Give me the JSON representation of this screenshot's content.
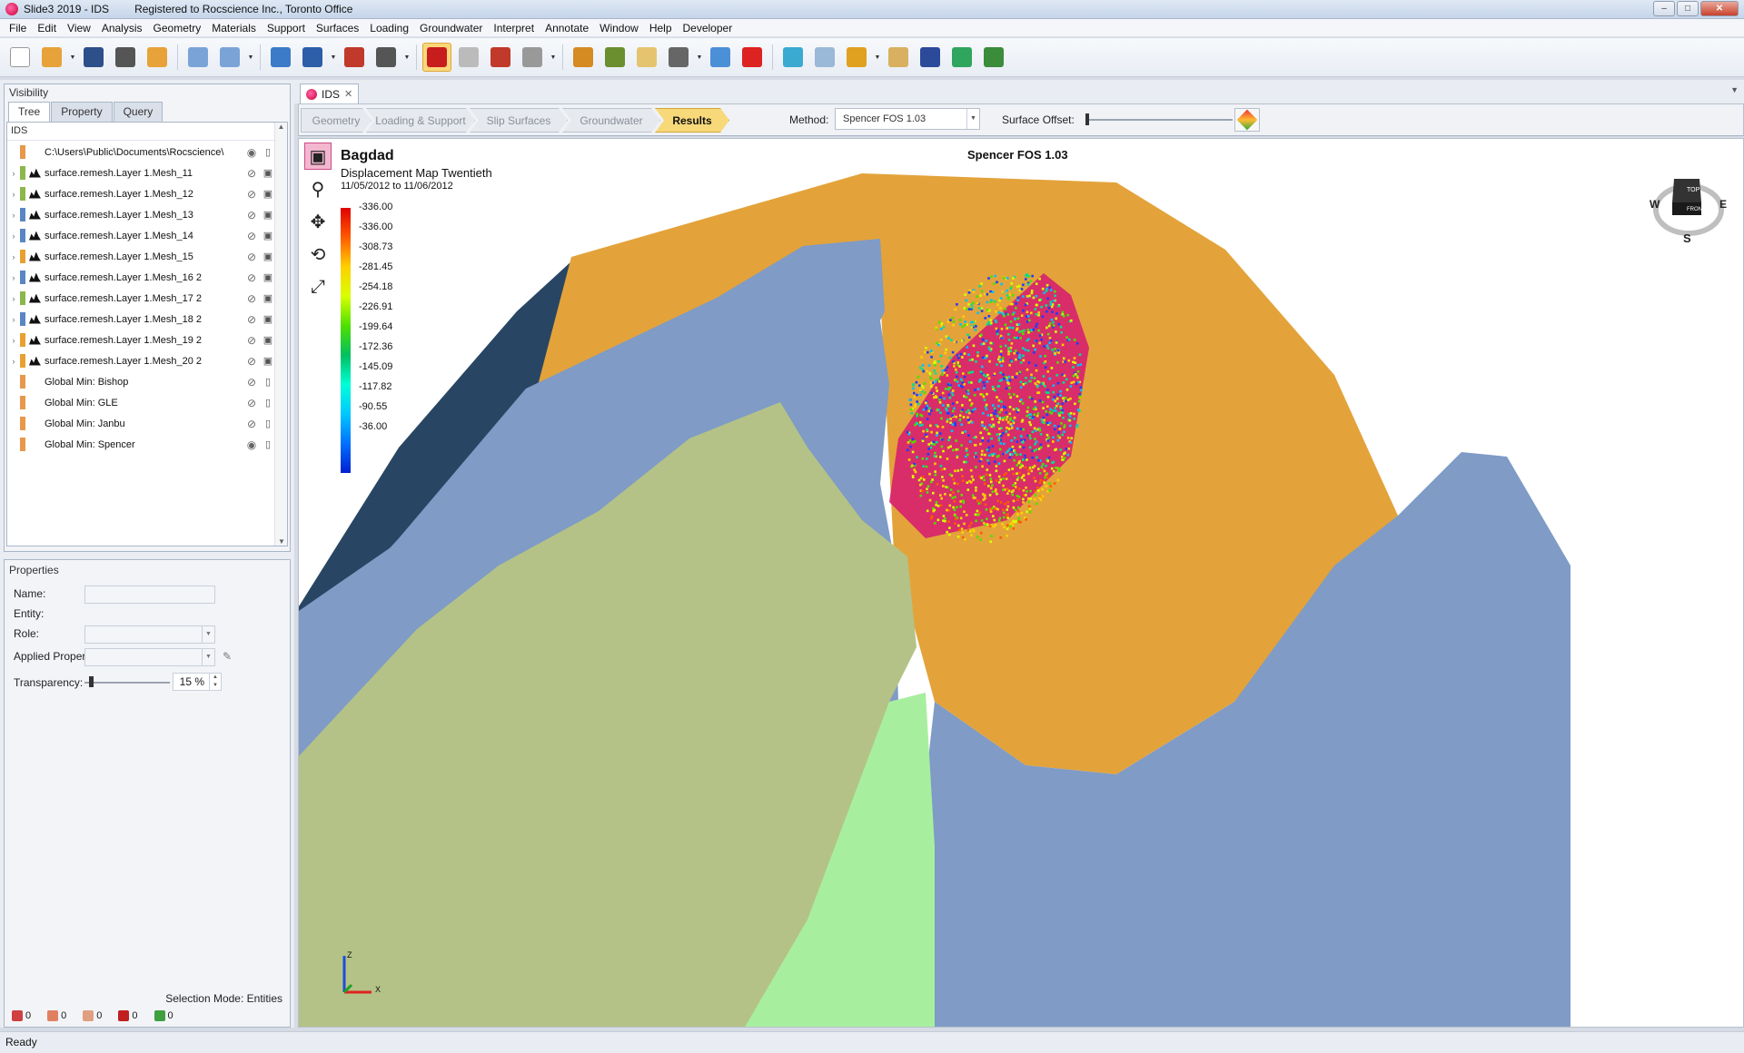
{
  "window": {
    "title": "Slide3 2019 - IDS",
    "registration": "Registered to Rocscience Inc., Toronto Office"
  },
  "menu": [
    "File",
    "Edit",
    "View",
    "Analysis",
    "Geometry",
    "Materials",
    "Support",
    "Surfaces",
    "Loading",
    "Groundwater",
    "Interpret",
    "Annotate",
    "Window",
    "Help",
    "Developer"
  ],
  "toolbar": {
    "icons": [
      "new-file-icon",
      "open-folder-icon",
      "save-icon",
      "print-icon",
      "export-icon",
      "undo-icon",
      "redo-icon",
      "grid-view-icon",
      "image-view-icon",
      "pointer-tool-icon",
      "calculator-icon",
      "solid-cube-icon",
      "wireframe-cube-icon",
      "select-box-icon",
      "deselect-icon",
      "excavation-icon",
      "materials-icon",
      "slope-icon",
      "compute-icon",
      "layers-icon",
      "section-icon",
      "display-cube-icon",
      "image-stack-icon",
      "chart-bars-icon",
      "tools-icon",
      "ids-icon",
      "contour-icon",
      "terrain-icon"
    ],
    "active_icon": "solid-cube-icon"
  },
  "visibility_panel": {
    "title": "Visibility",
    "tabs": [
      "Tree",
      "Property",
      "Query"
    ],
    "selected_tab": "Tree",
    "project_label": "IDS",
    "items": [
      {
        "label": "C:\\Users\\Public\\Documents\\Rocscience\\",
        "color": "#e8984a",
        "expandable": false,
        "mesh": false,
        "visible": true,
        "action": "delete"
      },
      {
        "label": "surface.remesh.Layer 1.Mesh_11",
        "color": "#8bb84a",
        "expandable": true,
        "mesh": true,
        "visible": false,
        "action": "lock"
      },
      {
        "label": "surface.remesh.Layer 1.Mesh_12",
        "color": "#8bb84a",
        "expandable": true,
        "mesh": true,
        "visible": false,
        "action": "lock"
      },
      {
        "label": "surface.remesh.Layer 1.Mesh_13",
        "color": "#5b86c4",
        "expandable": true,
        "mesh": true,
        "visible": false,
        "action": "lock"
      },
      {
        "label": "surface.remesh.Layer 1.Mesh_14",
        "color": "#5b86c4",
        "expandable": true,
        "mesh": true,
        "visible": false,
        "action": "lock"
      },
      {
        "label": "surface.remesh.Layer 1.Mesh_15",
        "color": "#e8a030",
        "expandable": true,
        "mesh": true,
        "visible": false,
        "action": "lock"
      },
      {
        "label": "surface.remesh.Layer 1.Mesh_16 2",
        "color": "#5b86c4",
        "expandable": true,
        "mesh": true,
        "visible": false,
        "action": "lock"
      },
      {
        "label": "surface.remesh.Layer 1.Mesh_17 2",
        "color": "#8bb84a",
        "expandable": true,
        "mesh": true,
        "visible": false,
        "action": "lock"
      },
      {
        "label": "surface.remesh.Layer 1.Mesh_18 2",
        "color": "#5b86c4",
        "expandable": true,
        "mesh": true,
        "visible": false,
        "action": "lock"
      },
      {
        "label": "surface.remesh.Layer 1.Mesh_19 2",
        "color": "#e8a030",
        "expandable": true,
        "mesh": true,
        "visible": false,
        "action": "lock"
      },
      {
        "label": "surface.remesh.Layer 1.Mesh_20 2",
        "color": "#e8a030",
        "expandable": true,
        "mesh": true,
        "visible": false,
        "action": "lock"
      },
      {
        "label": "Global Min: Bishop",
        "color": "#e8984a",
        "expandable": false,
        "mesh": false,
        "visible": false,
        "action": "delete"
      },
      {
        "label": "Global Min: GLE",
        "color": "#e8984a",
        "expandable": false,
        "mesh": false,
        "visible": false,
        "action": "delete"
      },
      {
        "label": "Global Min: Janbu",
        "color": "#e8984a",
        "expandable": false,
        "mesh": false,
        "visible": false,
        "action": "delete"
      },
      {
        "label": "Global Min: Spencer",
        "color": "#e8984a",
        "expandable": false,
        "mesh": false,
        "visible": true,
        "action": "delete"
      }
    ]
  },
  "properties_panel": {
    "title": "Properties",
    "name_label": "Name:",
    "entity_label": "Entity:",
    "role_label": "Role:",
    "applied_property_label": "Applied Property:",
    "transparency_label": "Transparency:",
    "transparency_value": "15 %",
    "transparency_fraction": 0.15,
    "selection_mode": "Selection Mode: Entities",
    "counts": [
      {
        "icon": "vertex-count-icon",
        "color": "#d04040",
        "value": "0"
      },
      {
        "icon": "edge-count-icon",
        "color": "#e08060",
        "value": "0"
      },
      {
        "icon": "face-count-icon",
        "color": "#e0a080",
        "value": "0"
      },
      {
        "icon": "solid-count-icon",
        "color": "#c02020",
        "value": "0"
      },
      {
        "icon": "group-count-icon",
        "color": "#40a040",
        "value": "0"
      }
    ]
  },
  "document": {
    "tab_label": "IDS",
    "workflow_steps": [
      "Geometry",
      "Loading & Support",
      "Slip Surfaces",
      "Groundwater",
      "Results"
    ],
    "current_step": "Results",
    "method_label": "Method:",
    "method_value": "Spencer FOS     1.03",
    "surface_offset_label": "Surface Offset:"
  },
  "viewport": {
    "legend_title": "Bagdad",
    "legend_subtitle": "Displacement Map Twentieth",
    "legend_dates": "11/05/2012 to 11/06/2012",
    "legend_ticks": [
      "-336.00",
      "-336.00",
      "-308.73",
      "-281.45",
      "-254.18",
      "-226.91",
      "-199.64",
      "-172.36",
      "-145.09",
      "-117.82",
      "-90.55",
      "-36.00"
    ],
    "fos_label": "Spencer FOS 1.03",
    "nav_cube": {
      "top": "TOP",
      "front": "FRONT",
      "west": "W",
      "east": "E",
      "south": "S"
    },
    "axes": {
      "z": "Z",
      "x": "X"
    },
    "colors": {
      "orange": "#e3a33a",
      "blue": "#7f9bc6",
      "green": "#b4c287",
      "light_green": "#a7ef9f",
      "dark_blue": "#284663"
    }
  },
  "status": "Ready"
}
